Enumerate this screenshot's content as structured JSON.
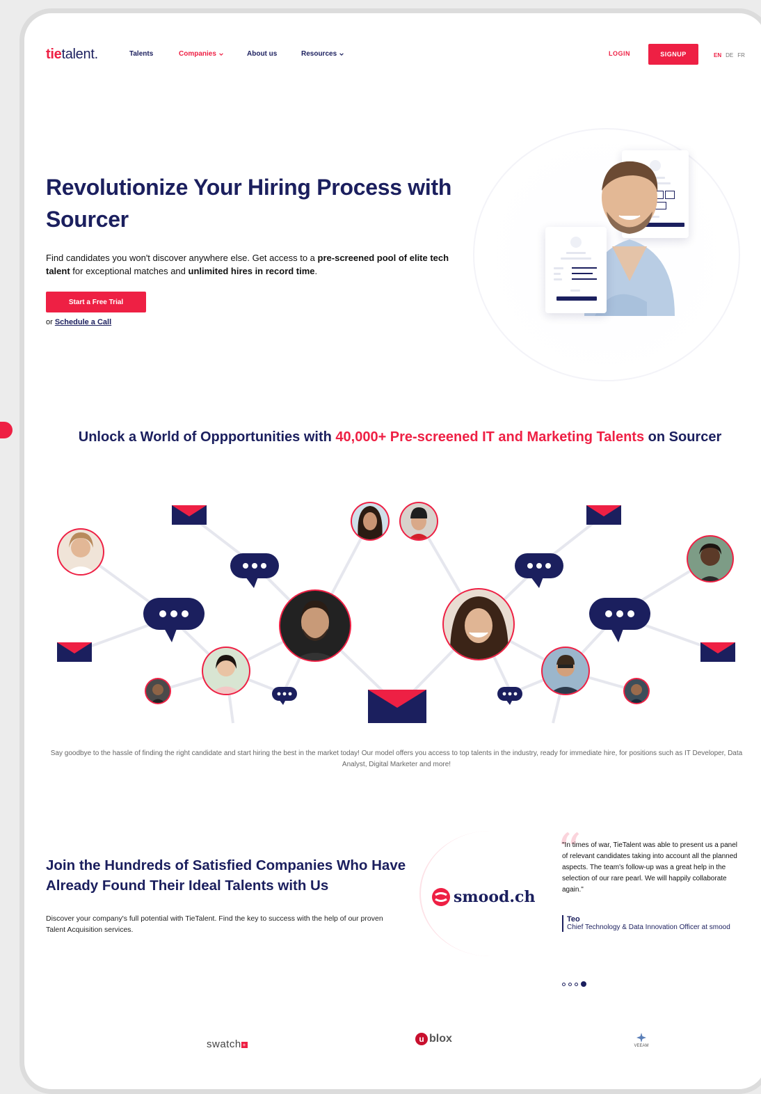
{
  "nav": {
    "logo_tie": "tie",
    "logo_talent": "talent.",
    "items": [
      "Talents",
      "Companies",
      "About us",
      "Resources"
    ],
    "login": "LOGIN",
    "signup": "SIGNUP",
    "langs": [
      "EN",
      "DE",
      "FR"
    ]
  },
  "hero": {
    "title": "Revolutionize Your Hiring Process with Sourcer",
    "desc_1": "Find candidates you won't discover anywhere else. Get access to a ",
    "desc_b1": "pre-screened pool of elite tech talent",
    "desc_2": " for exceptional matches and ",
    "desc_b2": "unlimited hires in record time",
    "desc_3": ".",
    "cta": "Start a Free Trial",
    "or": "or ",
    "schedule": "Schedule a Call"
  },
  "section2": {
    "title_1": "Unlock a World of Oppportunities with ",
    "title_hl": "40,000+ Pre-screened IT and Marketing Talents",
    "title_2": " on Sourcer",
    "desc": "Say goodbye to the hassle of finding the right candidate and start hiring the best in the market today! Our model offers you access to top talents in the industry, ready for immediate hire, for positions such as IT Developer, Data Analyst, Digital Marketer and more!"
  },
  "section3": {
    "title": "Join the Hundreds of Satisfied Companies Who Have Already Found Their Ideal Talents with Us",
    "desc": "Discover your company's full potential with TieTalent. Find the key to success with the help of our proven Talent Acquisition services.",
    "company_logo": "smood.ch",
    "quote": "\"In times of war, TieTalent was able to present us a panel of relevant candidates taking into account all the planned aspects. The team's follow-up was a great help in the selection of our rare pearl. We will happily collaborate again.\"",
    "author_name": "Teo",
    "author_role": "Chief Technology & Data Innovation Officer at smood",
    "carousel_total": 4,
    "carousel_active": 4
  },
  "logos": {
    "swatch": "swatch",
    "ublox": "blox",
    "veeam": "VEEAM"
  },
  "colors": {
    "brand_red": "#ee2044",
    "navy": "#1b1f5e"
  }
}
